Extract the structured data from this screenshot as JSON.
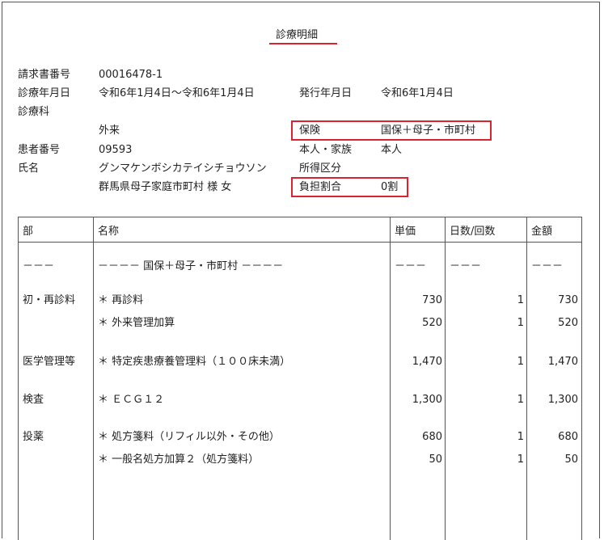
{
  "title": "診療明細",
  "header": {
    "invoice_no_label": "請求書番号",
    "invoice_no": "00016478-1",
    "period_label": "診療年月日",
    "period": "令和6年1月4日～令和6年1月4日",
    "issue_label": "発行年月日",
    "issue_date": "令和6年1月4日",
    "dept_label": "診療科",
    "visit_type": "外来",
    "insurance_label": "保険",
    "insurance": "国保＋母子・市町村",
    "patient_no_label": "患者番号",
    "patient_no": "09593",
    "relation_label": "本人・家族",
    "relation": "本人",
    "name_label": "氏名",
    "name_kana": "グンマケンボシカテイシチョウソン",
    "income_label": "所得区分",
    "name_full": "群馬県母子家庭市町村 様 女",
    "burden_label": "負担割合",
    "burden": "0割"
  },
  "table": {
    "headers": [
      "部",
      "名称",
      "単価",
      "日数/回数",
      "金額"
    ],
    "separator": {
      "dept": "－－－",
      "name": "－－－－ 国保＋母子・市町村 －－－－",
      "price": "－－－",
      "qty": "－－－",
      "amount": "－－－"
    },
    "rows": [
      {
        "dept": "初・再診料",
        "name": "＊ 再診料",
        "price": "730",
        "qty": "1",
        "amount": "730"
      },
      {
        "dept": "",
        "name": "＊ 外来管理加算",
        "price": "520",
        "qty": "1",
        "amount": "520"
      },
      {
        "dept": "医学管理等",
        "name": "＊ 特定疾患療養管理料（１００床未満）",
        "price": "1,470",
        "qty": "1",
        "amount": "1,470"
      },
      {
        "dept": "検査",
        "name": "＊ ＥＣＧ１２",
        "price": "1,300",
        "qty": "1",
        "amount": "1,300"
      },
      {
        "dept": "投薬",
        "name": "＊ 処方箋料（リフィル以外・その他）",
        "price": "680",
        "qty": "1",
        "amount": "680"
      },
      {
        "dept": "",
        "name": "＊ 一般名処方加算２（処方箋料）",
        "price": "50",
        "qty": "1",
        "amount": "50"
      }
    ]
  },
  "colors": {
    "highlight": "#d9232e",
    "border": "#555555"
  }
}
